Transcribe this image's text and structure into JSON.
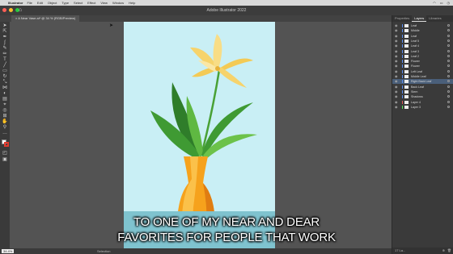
{
  "menubar": {
    "apple": "",
    "app": "Illustrator",
    "items": [
      "File",
      "Edit",
      "Object",
      "Type",
      "Select",
      "Effect",
      "View",
      "Window",
      "Help"
    ],
    "status_icons": [
      "wifi-icon",
      "battery-icon",
      "clock-icon"
    ]
  },
  "window": {
    "title": "Adobe Illustrator 2022",
    "home_icon": "home-icon"
  },
  "document_tab": {
    "label": "A Near Vase.ai* @ 34 % (RGB/Preview)"
  },
  "tools": [
    "selection-tool-icon",
    "direct-selection-tool-icon",
    "pen-tool-icon",
    "curvature-tool-icon",
    "brush-tool-icon",
    "pencil-tool-icon",
    "type-tool-icon",
    "line-tool-icon",
    "rectangle-tool-icon",
    "rotate-tool-icon",
    "scale-tool-icon",
    "width-tool-icon",
    "shape-builder-tool-icon",
    "gradient-tool-icon",
    "eyedropper-tool-icon",
    "blend-tool-icon",
    "artboard-tool-icon",
    "hand-tool-icon",
    "zoom-tool-icon",
    "edit-toolbar-icon"
  ],
  "colors": {
    "fill": "#ffffff",
    "stroke": "#e03a2f",
    "artboard": "#c9eff5",
    "water": "#7fc3cf",
    "selection": "#4a5f7a"
  },
  "caption": {
    "line1": "TO ONE OF MY NEAR AND DEAR",
    "line2": "FAVORITES FOR PEOPLE THAT WORK"
  },
  "statusbar": {
    "zoom": "34.4%",
    "tool": "Selection"
  },
  "panel": {
    "tabs": [
      "Properties",
      "Layers",
      "Libraries"
    ],
    "active_tab": "Layers",
    "layers": [
      {
        "name": "Leaf",
        "color": "#5b8def"
      },
      {
        "name": "Middle",
        "color": "#5b8def"
      },
      {
        "name": "Leaf",
        "color": "#5b8def"
      },
      {
        "name": "Leaf 5",
        "color": "#5b8def"
      },
      {
        "name": "Leaf 4",
        "color": "#5b8def"
      },
      {
        "name": "Leaf 3",
        "color": "#5b8def"
      },
      {
        "name": "Leaf 2",
        "color": "#5b8def"
      },
      {
        "name": "Flower",
        "color": "#5b8def"
      },
      {
        "name": "Flower",
        "color": "#5b8def"
      },
      {
        "name": "Left Leaf",
        "color": "#5b8def"
      },
      {
        "name": "Middle Leaf",
        "color": "#5b8def"
      },
      {
        "name": "Right Back Leaf",
        "color": "#5b8def"
      },
      {
        "name": "Back Leaf",
        "color": "#5b8def"
      },
      {
        "name": "Stem",
        "color": "#5b8def"
      },
      {
        "name": "Shadows",
        "color": "#5b8def"
      },
      {
        "name": "Layer 4",
        "color": "#e05a5a"
      },
      {
        "name": "Layer 3",
        "color": "#5be05a"
      }
    ],
    "selected_index": 11,
    "footer": "17 La..."
  }
}
